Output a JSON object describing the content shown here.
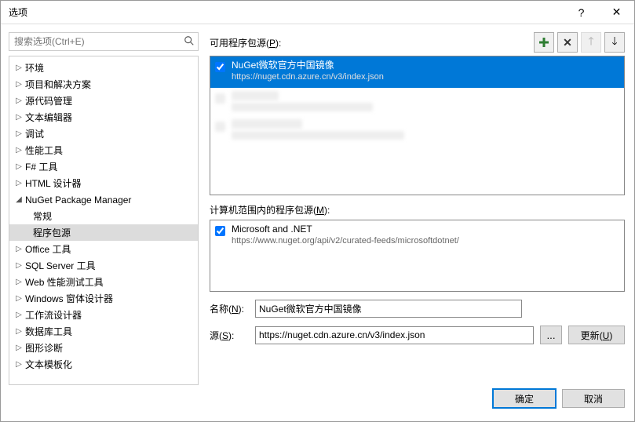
{
  "window": {
    "title": "选项",
    "help": "?",
    "close": "✕"
  },
  "search": {
    "placeholder": "搜索选项(Ctrl+E)"
  },
  "tree": {
    "items": [
      {
        "label": "环境",
        "expanded": false
      },
      {
        "label": "项目和解决方案",
        "expanded": false
      },
      {
        "label": "源代码管理",
        "expanded": false
      },
      {
        "label": "文本编辑器",
        "expanded": false
      },
      {
        "label": "调试",
        "expanded": false
      },
      {
        "label": "性能工具",
        "expanded": false
      },
      {
        "label": "F# 工具",
        "expanded": false
      },
      {
        "label": "HTML 设计器",
        "expanded": false
      },
      {
        "label": "NuGet Package Manager",
        "expanded": true,
        "children": [
          {
            "label": "常规",
            "selected": false
          },
          {
            "label": "程序包源",
            "selected": true
          }
        ]
      },
      {
        "label": "Office 工具",
        "expanded": false
      },
      {
        "label": "SQL Server 工具",
        "expanded": false
      },
      {
        "label": "Web 性能测试工具",
        "expanded": false
      },
      {
        "label": "Windows 窗体设计器",
        "expanded": false
      },
      {
        "label": "工作流设计器",
        "expanded": false
      },
      {
        "label": "数据库工具",
        "expanded": false
      },
      {
        "label": "图形诊断",
        "expanded": false
      },
      {
        "label": "文本模板化",
        "expanded": false
      }
    ]
  },
  "sources": {
    "label_pre": "可用程序包源(",
    "label_u": "P",
    "label_post": "):",
    "items": [
      {
        "name": "NuGet微软官方中国镜像",
        "url": "https://nuget.cdn.azure.cn/v3/index.json",
        "checked": true,
        "selected": true
      }
    ]
  },
  "machine": {
    "label_pre": "计算机范围内的程序包源(",
    "label_u": "M",
    "label_post": "):",
    "items": [
      {
        "name": "Microsoft and .NET",
        "url": "https://www.nuget.org/api/v2/curated-feeds/microsoftdotnet/",
        "checked": true
      }
    ]
  },
  "fields": {
    "name_label_pre": "名称(",
    "name_label_u": "N",
    "name_label_post": "):",
    "name_value": "NuGet微软官方中国镜像",
    "src_label_pre": "源(",
    "src_label_u": "S",
    "src_label_post": "):",
    "src_value": "https://nuget.cdn.azure.cn/v3/index.json",
    "browse": "...",
    "update_pre": "更新(",
    "update_u": "U",
    "update_post": ")"
  },
  "footer": {
    "ok": "确定",
    "cancel": "取消"
  }
}
